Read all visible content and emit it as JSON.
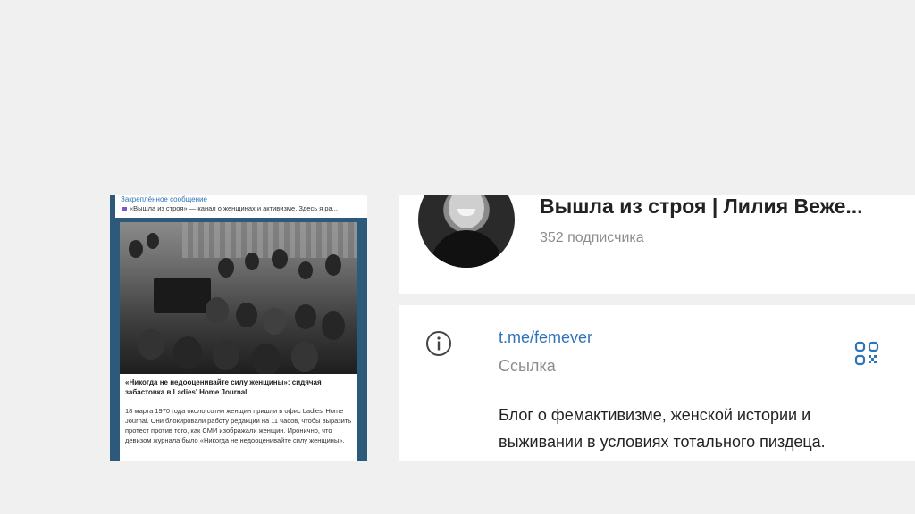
{
  "left_preview": {
    "pinned": {
      "title": "Закреплённое сообщение",
      "preview": "«Вышла из строя» — канал о женщинах и активизме.   Здесь я ра..."
    },
    "post": {
      "photo_icon": "photo-crowd-sit-in",
      "title": "«Никогда не недооценивайте силу женщины»: сидячая забастовка в Ladies' Home Journal",
      "text": "18 марта 1970 года около сотни женщин пришли в офис Ladies' Home Journal. Они блокировали работу редакции на 11 часов, чтобы выразить протест против того, как СМИ изображали женщин. Иронично, что девизом журнала было «Никогда не недооценивайте силу женщины»."
    }
  },
  "profile": {
    "avatar_icon": "avatar-photo",
    "title": "Вышла из строя | Лилия Веже...",
    "subscribers": "352 подписчика"
  },
  "info": {
    "info_icon": "info-icon",
    "link": "t.me/femever",
    "link_label": "Ссылка",
    "qr_icon": "qr-code-icon",
    "description": "Блог о фемактивизме, женской истории и выживании в условиях тотального пиздеца."
  },
  "colors": {
    "background": "#f0f0f0",
    "accent": "#2f73b8",
    "chat_bg": "#2d5a7b",
    "muted": "#8c8c8c",
    "pinned_marker": "#7a59c6"
  }
}
